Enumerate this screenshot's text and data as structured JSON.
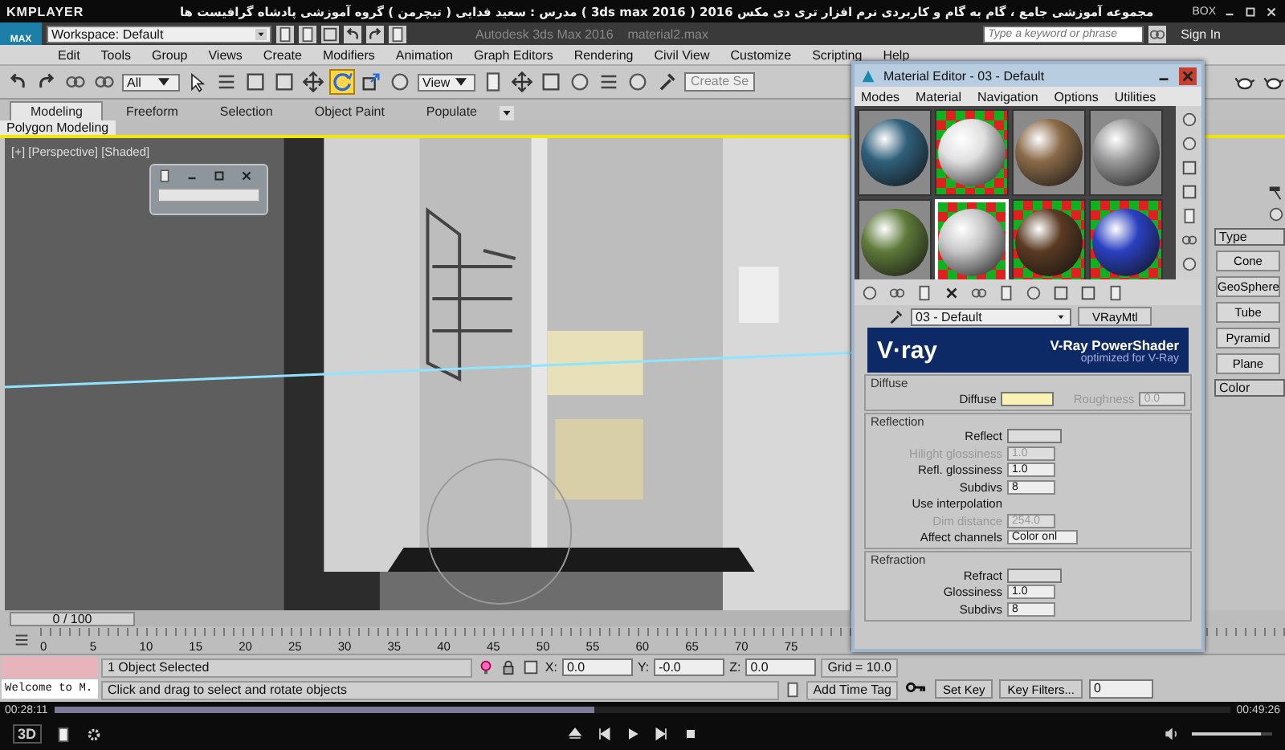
{
  "player": {
    "brand": "KMPLAYER",
    "title": "مجموعه آموزشی جامع ، گام به گام و کاربردی نرم افزار تری دی مکس 2016 ( 3ds max 2016 )  مدرس : سعید فدایی ( تیچرمن ) گروه آموزشی پادشاه گرافیست ها",
    "corner_label": "BOX",
    "elapsed": "00:28:11",
    "total": "00:49:26",
    "progress": {
      "level": 0.46
    },
    "volume": {
      "level": 0.85
    },
    "badge": "3D"
  },
  "app": {
    "logo": "MAX",
    "workspace": "Workspace: Default",
    "window_title": "Autodesk 3ds Max 2016    material2.max",
    "search": {
      "placeholder": "Type a keyword or phrase"
    },
    "sign_in": "Sign In",
    "menu": [
      "Edit",
      "Tools",
      "Group",
      "Views",
      "Create",
      "Modifiers",
      "Animation",
      "Graph Editors",
      "Rendering",
      "Civil View",
      "Customize",
      "Scripting",
      "Help"
    ],
    "selection_filter": "All",
    "reference_coord": "View",
    "named_selection": "Create Se",
    "tools": [
      {
        "kind": "move",
        "selected": false
      },
      {
        "kind": "rotate",
        "selected": true
      },
      {
        "kind": "scale",
        "selected": false
      }
    ],
    "ribbon_tabs": [
      {
        "label": "Modeling",
        "selected": true
      },
      {
        "label": "Freeform",
        "selected": false
      },
      {
        "label": "Selection",
        "selected": false
      },
      {
        "label": "Object Paint",
        "selected": false
      },
      {
        "label": "Populate",
        "selected": false
      }
    ],
    "ribbon_panel": "Polygon Modeling",
    "viewport": {
      "label": "[+] [Perspective] [Shaded]"
    },
    "command_panel": {
      "rollout": "Type",
      "buttons": [
        "Cone",
        "GeoSphere",
        "Tube",
        "Pyramid",
        "Plane"
      ],
      "rollout_2": "Color"
    },
    "time_slider": {
      "label": "0 / 100",
      "level": 0
    },
    "ruler_labels": [
      "0",
      "5",
      "10",
      "15",
      "20",
      "25",
      "30",
      "35",
      "40",
      "45",
      "50",
      "55",
      "60",
      "65",
      "70",
      "75"
    ],
    "status": {
      "listener": "Welcome to M.",
      "selection": "1 Object Selected",
      "coords": [
        {
          "label": "X:",
          "value": "0.0"
        },
        {
          "label": "Y:",
          "value": "-0.0"
        },
        {
          "label": "Z:",
          "value": "0.0"
        }
      ],
      "grid": "Grid = 10.0",
      "prompt": "Click and drag to select and rotate objects",
      "time_tag": "Add Time Tag",
      "set_key": "Set Key",
      "key_filters": "Key Filters...",
      "frame": "0"
    }
  },
  "material_editor": {
    "title": "Material Editor - 03 - Default",
    "menu": [
      "Modes",
      "Material",
      "Navigation",
      "Options",
      "Utilities"
    ],
    "slots": [
      {
        "kind": "plain",
        "color": "#2f5f7a",
        "selected": false
      },
      {
        "kind": "checker",
        "color": "#e0e0e0",
        "selected": false
      },
      {
        "kind": "plain",
        "color": "#8a6a48",
        "selected": false
      },
      {
        "kind": "plain",
        "color": "#9a9a9a",
        "selected": false
      },
      {
        "kind": "plain",
        "color": "#5f7a3a",
        "selected": false
      },
      {
        "kind": "checker",
        "color": "#c8c8c8",
        "selected": true
      },
      {
        "kind": "checker",
        "color": "#5a3a22",
        "selected": false
      },
      {
        "kind": "checker",
        "color": "#2a40c0",
        "selected": false
      }
    ],
    "material_name": "03 - Default",
    "material_type": "VRayMtl",
    "banner": {
      "logo": "V·ray",
      "title": "V-Ray PowerShader",
      "subtitle": "optimized for V-Ray"
    },
    "groups": [
      {
        "title": "Diffuse",
        "rows": [
          {
            "items": [
              {
                "kind": "swatch",
                "label": "Diffuse",
                "color": "#f8f3b4",
                "disabled": false
              },
              {
                "kind": "value",
                "label": "Roughness",
                "value": "0.0",
                "disabled": true
              }
            ]
          }
        ]
      },
      {
        "title": "Reflection",
        "rows": [
          {
            "items": [
              {
                "kind": "swatch",
                "label": "Reflect",
                "color": "#dcdcdc",
                "disabled": false
              }
            ]
          },
          {
            "items": [
              {
                "kind": "value",
                "label": "Hilight glossiness",
                "value": "1.0",
                "disabled": true
              }
            ]
          },
          {
            "items": [
              {
                "kind": "value",
                "label": "Refl. glossiness",
                "value": "1.0",
                "disabled": false
              }
            ]
          },
          {
            "items": [
              {
                "kind": "value",
                "label": "Subdivs",
                "value": "8",
                "disabled": false
              }
            ]
          },
          {
            "items": [
              {
                "kind": "label",
                "label": "Use interpolation",
                "disabled": false
              }
            ]
          },
          {
            "items": [
              {
                "kind": "value",
                "label": "Dim distance",
                "value": "254.0",
                "disabled": true
              }
            ]
          },
          {
            "items": [
              {
                "kind": "dropdown",
                "label": "Affect channels",
                "value": "Color onl",
                "disabled": false
              }
            ]
          }
        ]
      },
      {
        "title": "Refraction",
        "rows": [
          {
            "items": [
              {
                "kind": "swatch",
                "label": "Refract",
                "color": "#dcdcdc",
                "disabled": false
              }
            ]
          },
          {
            "items": [
              {
                "kind": "value",
                "label": "Glossiness",
                "value": "1.0",
                "disabled": false
              }
            ]
          },
          {
            "items": [
              {
                "kind": "value",
                "label": "Subdivs",
                "value": "8",
                "disabled": false
              }
            ]
          }
        ]
      }
    ]
  }
}
